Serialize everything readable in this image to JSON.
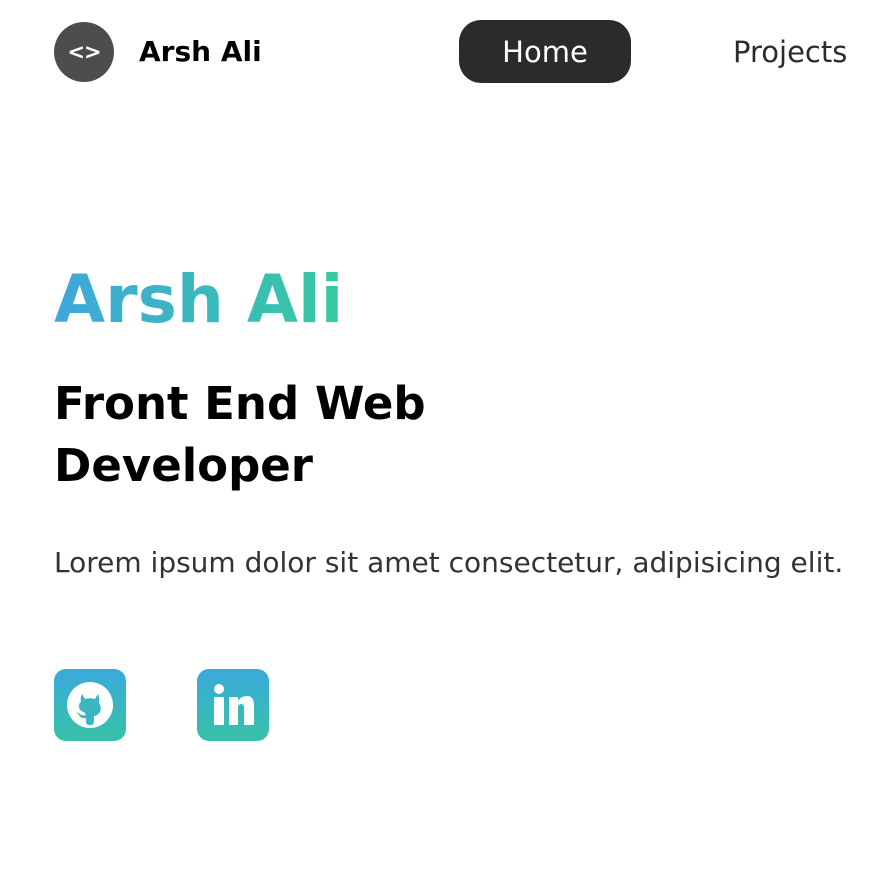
{
  "header": {
    "logo_glyph": "<>",
    "brand_name": "Arsh Ali",
    "nav": {
      "home_label": "Home",
      "projects_label": "Projects"
    }
  },
  "hero": {
    "name": "Arsh Ali",
    "title": "Front End Web Developer",
    "description": "Lorem ipsum dolor sit amet consectetur, adipisicing elit."
  },
  "social": {
    "items": [
      {
        "icon": "github-icon"
      },
      {
        "icon": "linkedin-icon"
      }
    ]
  },
  "colors": {
    "accent_gradient_start": "#3fa7dc",
    "accent_gradient_end": "#36c9a0",
    "nav_active_bg": "#2b2b2b",
    "logo_bg": "#4d4d4d"
  }
}
